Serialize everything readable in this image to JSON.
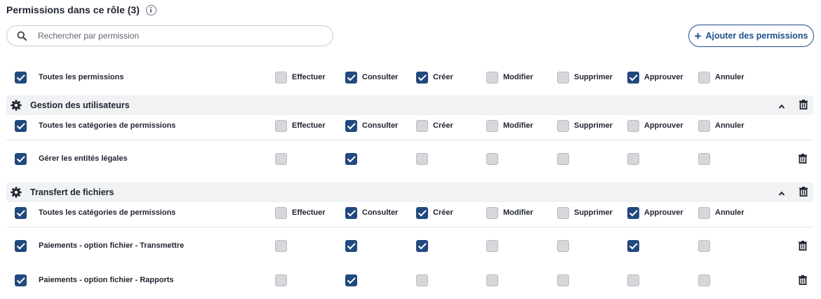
{
  "header": {
    "title": "Permissions dans ce rôle (3)",
    "info_icon": "info-icon"
  },
  "search": {
    "placeholder": "Rechercher par permission",
    "value": ""
  },
  "add_button": {
    "label": "Ajouter des permissions",
    "icon": "plus-icon"
  },
  "columns": [
    "Effectuer",
    "Consulter",
    "Créer",
    "Modifier",
    "Supprimer",
    "Approuver",
    "Annuler"
  ],
  "all_permissions": {
    "label": "Toutes les permissions",
    "checked": true,
    "values": [
      false,
      true,
      true,
      false,
      false,
      true,
      false
    ]
  },
  "groups": [
    {
      "name": "Gestion des utilisateurs",
      "icon": "gear-icon",
      "all_label": "Toutes les catégories de permissions",
      "all_checked": true,
      "all_values": [
        false,
        true,
        false,
        false,
        false,
        false,
        false
      ],
      "items": [
        {
          "label": "Gérer les entités légales",
          "checked": true,
          "values": [
            false,
            true,
            false,
            false,
            false,
            false,
            false
          ]
        }
      ]
    },
    {
      "name": "Transfert de fichiers",
      "icon": "gear-icon",
      "all_label": "Toutes les catégories de permissions",
      "all_checked": true,
      "all_values": [
        false,
        true,
        true,
        false,
        false,
        true,
        false
      ],
      "items": [
        {
          "label": "Paiements - option fichier - Transmettre",
          "checked": true,
          "values": [
            false,
            true,
            true,
            false,
            false,
            true,
            false
          ]
        },
        {
          "label": "Paiements - option fichier - Rapports",
          "checked": true,
          "values": [
            false,
            true,
            false,
            false,
            false,
            false,
            false
          ]
        }
      ]
    }
  ],
  "colors": {
    "accent": "#21497d",
    "unchecked": "#d6d7da",
    "group_bg": "#f1f2f4"
  }
}
